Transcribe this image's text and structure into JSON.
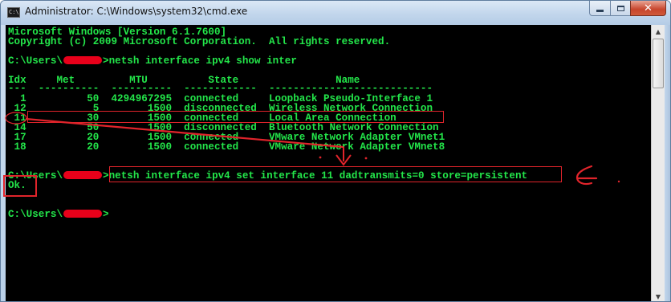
{
  "window": {
    "title": "Administrator: C:\\Windows\\system32\\cmd.exe",
    "app_icon_text": "C:\\"
  },
  "console": {
    "lines": {
      "version": "Microsoft Windows [Version 6.1.7600]",
      "copyright": "Copyright (c) 2009 Microsoft Corporation.  All rights reserved.",
      "prompt_prefix": "C:\\Users\\",
      "prompt_suffix": ">",
      "command1": "netsh interface ipv4 show inter",
      "table_header": "Idx     Met         MTU          State                Name",
      "table_separator": "---  ----------  ----------  ------------  ---------------------------",
      "rows": [
        "  1          50  4294967295  connected     Loopback Pseudo-Interface 1",
        " 12           5        1500  disconnected  Wireless Network Connection",
        " 11          30        1500  connected     Local Area Connection",
        " 14          50        1500  disconnected  Bluetooth Network Connection",
        " 17          20        1500  connected     VMware Network Adapter VMnet1",
        " 18          20        1500  connected     VMware Network Adapter VMnet8"
      ],
      "command2": "netsh interface ipv4 set interface 11 dadtransmits=0 store=persistent",
      "result": "Ok."
    }
  },
  "colors": {
    "console_background": "#000000",
    "console_text": "#23e64a",
    "annotation_red": "#e0242b",
    "redaction_red": "#e8001a"
  },
  "icons": {
    "app": "cmd-icon",
    "minimize": "minimize-icon",
    "maximize": "maximize-icon",
    "close": "close-icon",
    "scroll_up": "scroll-up-arrow-icon",
    "scroll_down": "scroll-down-arrow-icon"
  }
}
